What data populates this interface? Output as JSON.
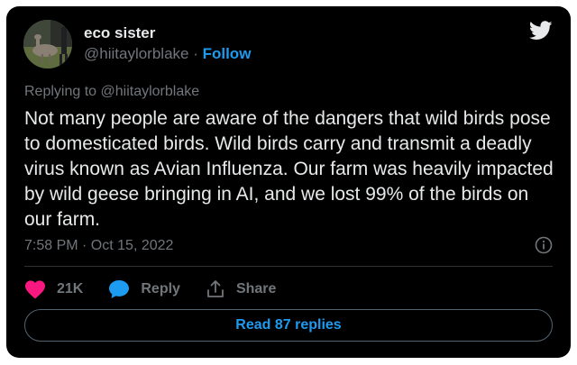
{
  "author": {
    "name": "eco sister",
    "handle": "@hiitaylorblake",
    "separator": " · ",
    "follow_label": "Follow"
  },
  "tweet": {
    "replying_to": "Replying to @hiitaylorblake",
    "text": "Not many people are aware of the dangers that wild birds pose to domesticated birds. Wild birds carry and transmit a deadly virus known as Avian Influenza. Our farm was heavily impacted by wild geese bringing in AI, and we lost 99% of the birds on our farm.",
    "timestamp": "7:58 PM · Oct 15, 2022"
  },
  "actions": {
    "like_count": "21K",
    "reply_label": "Reply",
    "share_label": "Share"
  },
  "footer": {
    "read_replies_label": "Read 87 replies"
  },
  "icons": {
    "brand": "twitter-bird-icon",
    "info": "info-icon",
    "like": "heart-icon",
    "reply": "speech-bubble-icon",
    "share": "share-icon"
  },
  "colors": {
    "background": "#000000",
    "text": "#e7e9ea",
    "muted": "#71767b",
    "accent": "#1d9bf0",
    "like": "#f91880"
  }
}
